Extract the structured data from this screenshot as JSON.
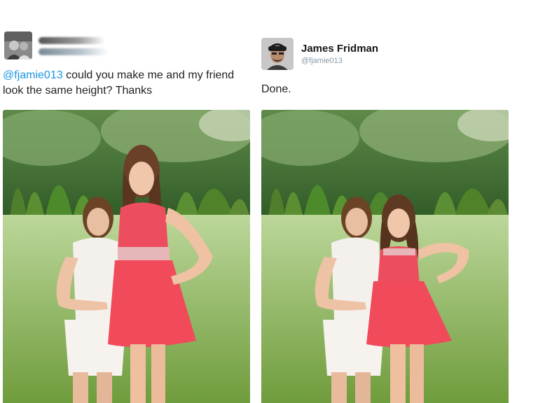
{
  "left_tweet": {
    "mention": "@fjamie013",
    "text": " could you make me and my friend look the same height? Thanks"
  },
  "right_tweet": {
    "display_name": "James Fridman",
    "handle": "@fjamie013",
    "text": "Done."
  }
}
